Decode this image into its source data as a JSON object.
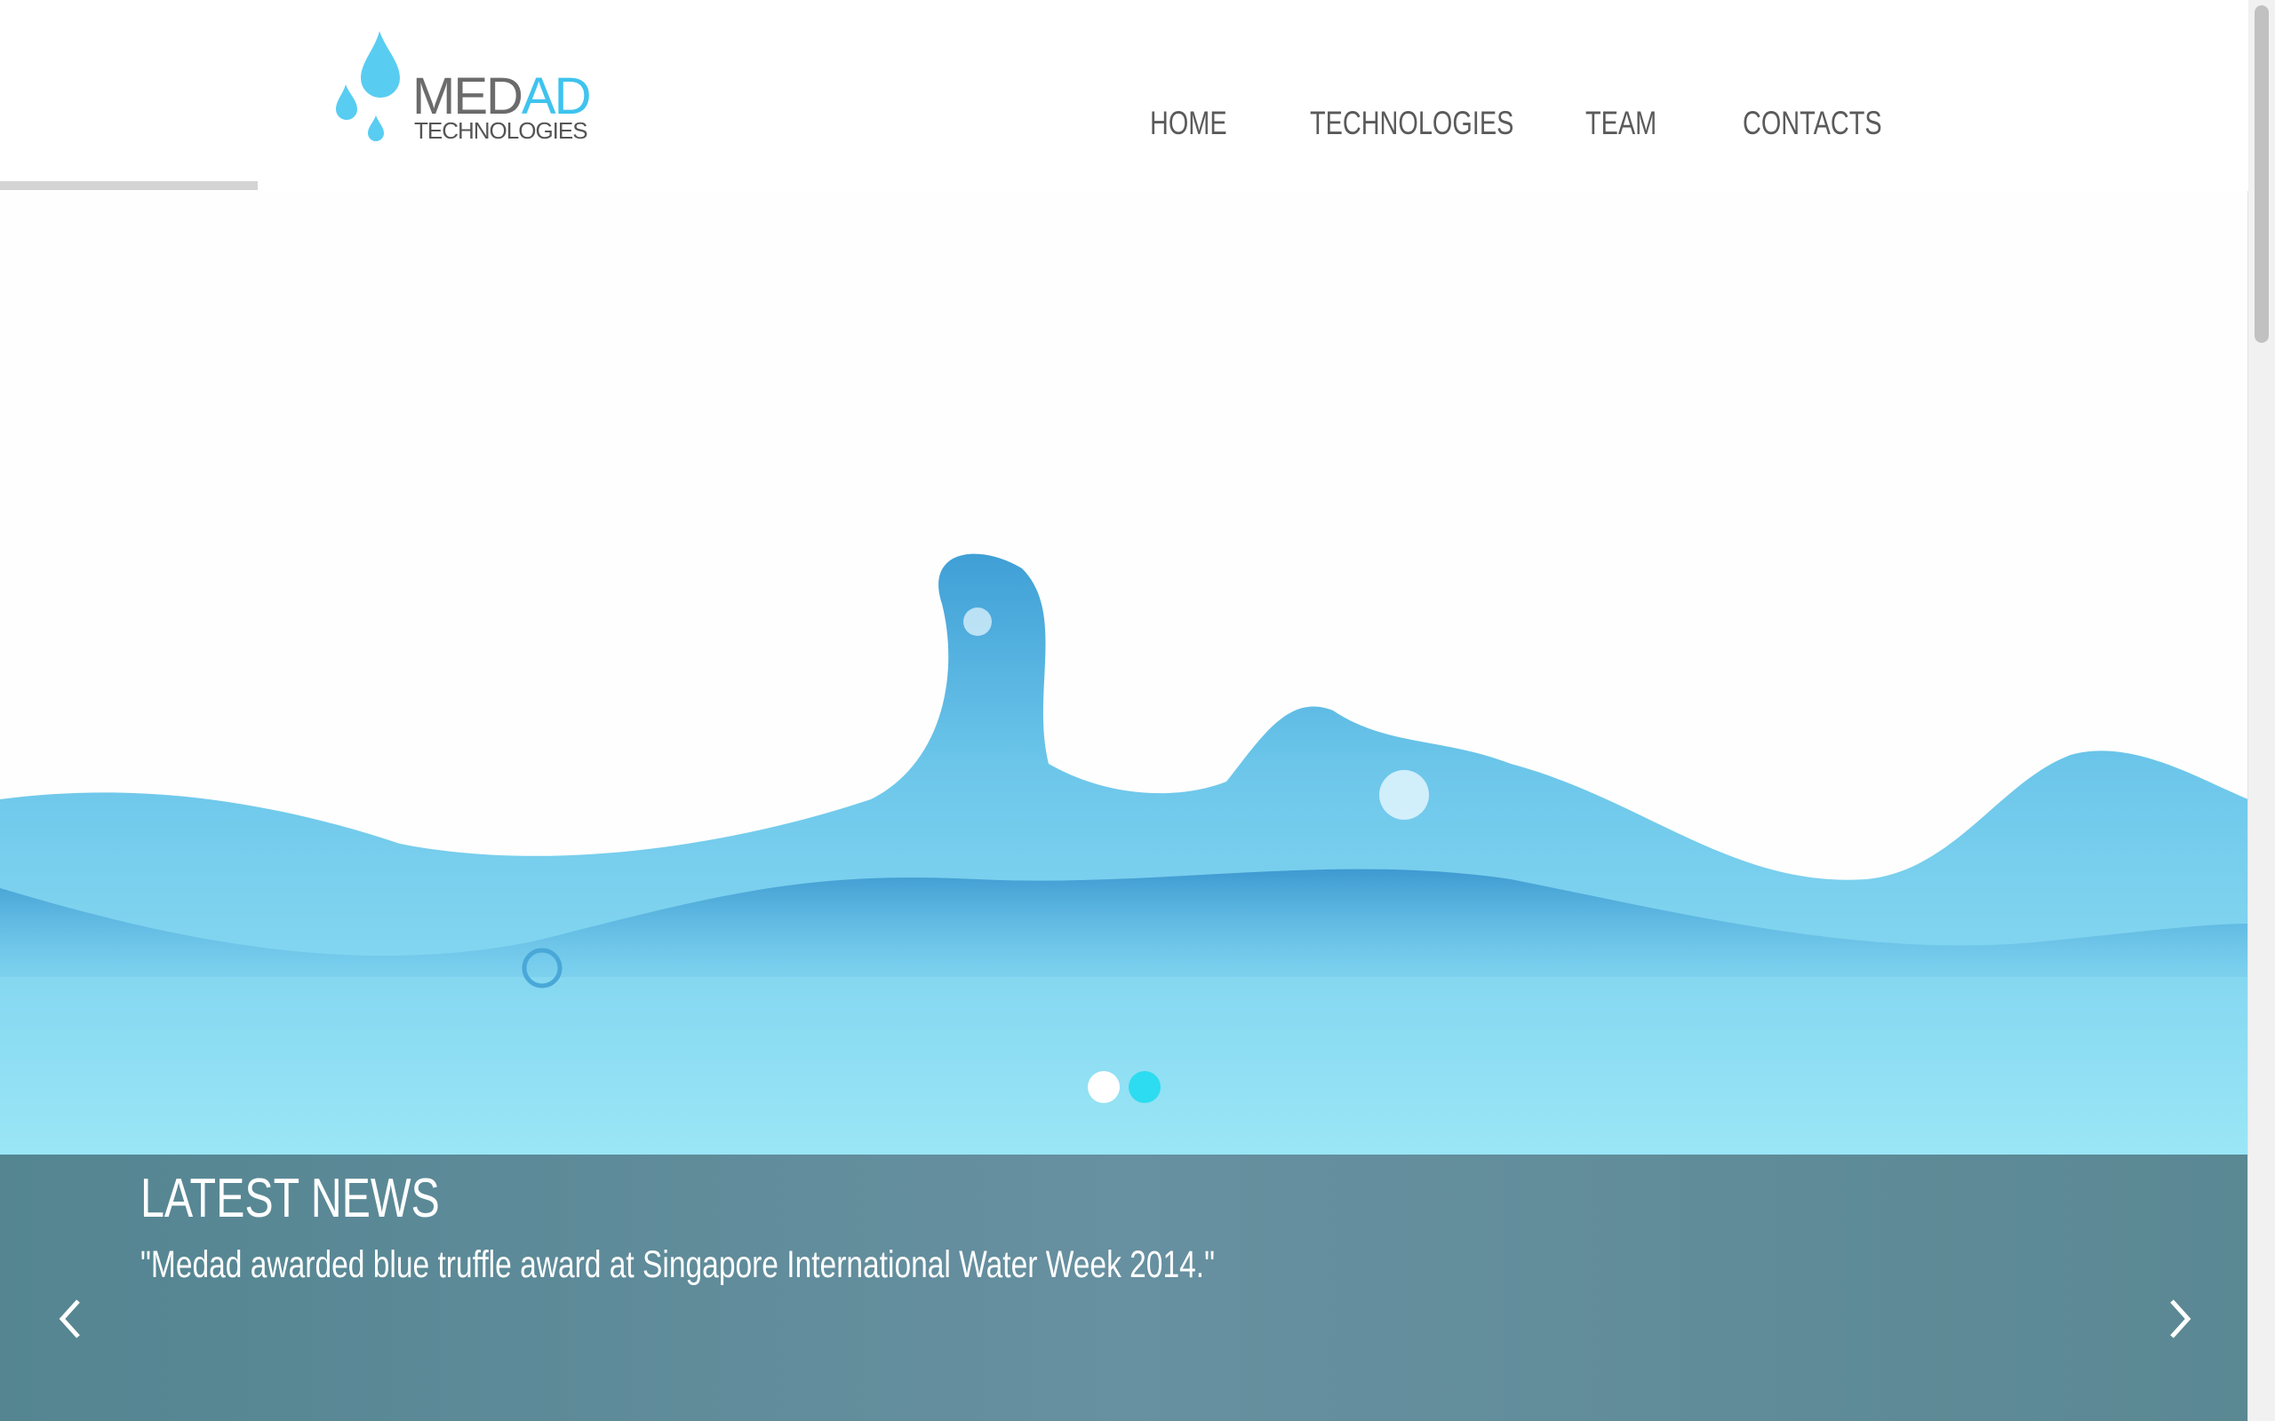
{
  "logo": {
    "text_main": "MED",
    "text_accent": "AD",
    "text_sub": "TECHNOLOGIES"
  },
  "nav": {
    "items": [
      {
        "label": "HOME"
      },
      {
        "label": "TECHNOLOGIES"
      },
      {
        "label": "TEAM"
      },
      {
        "label": "CONTACTS"
      }
    ]
  },
  "slider": {
    "slide_count": 2,
    "active_slide": 2,
    "dot_inactive_color": "#ffffff",
    "dot_active_color": "#2ddcf0"
  },
  "news": {
    "title": "LATEST NEWS",
    "text": "\"Medad awarded blue truffle award at Singapore International Water Week 2014.\"",
    "prev_icon": "chevron-left-icon",
    "next_icon": "chevron-right-icon"
  },
  "colors": {
    "accent": "#3fc3ee",
    "news_panel": "#5a8a94",
    "nav_text": "#5a5a5a"
  }
}
